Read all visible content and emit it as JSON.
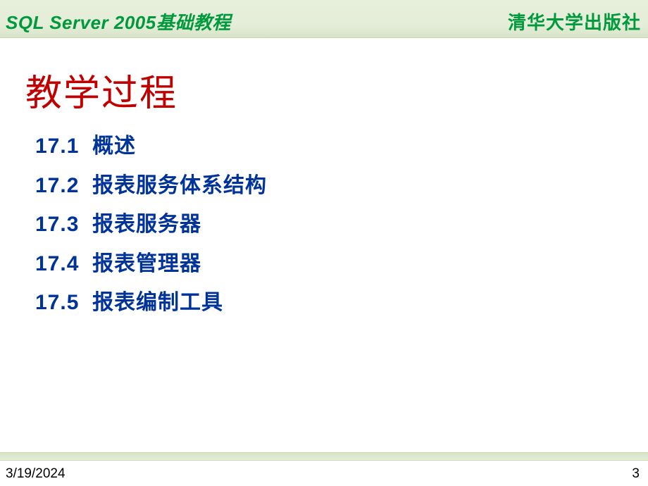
{
  "header": {
    "left": "SQL Server 2005基础教程",
    "right": "清华大学出版社"
  },
  "title": "教学过程",
  "toc": [
    {
      "num": "17.1",
      "label": "概述"
    },
    {
      "num": "17.2",
      "label": "报表服务体系结构"
    },
    {
      "num": "17.3",
      "label": "报表服务器"
    },
    {
      "num": "17.4",
      "label": "报表管理器"
    },
    {
      "num": "17.5",
      "label": "报表编制工具"
    }
  ],
  "footer": {
    "date": "3/19/2024",
    "page": "3"
  }
}
